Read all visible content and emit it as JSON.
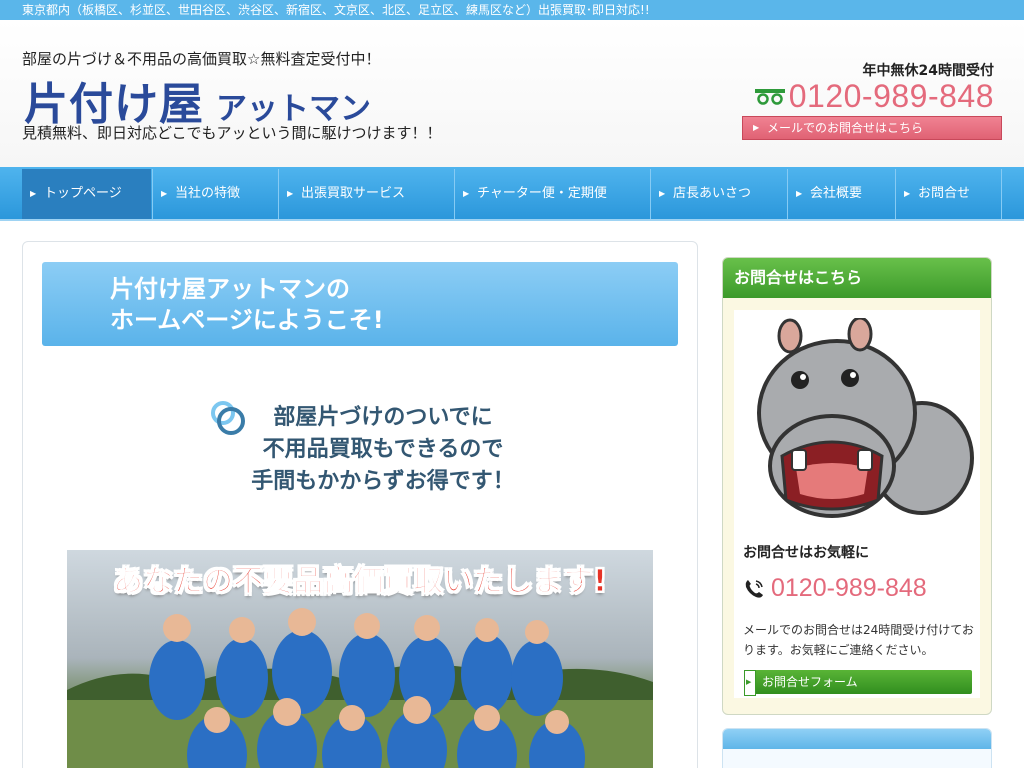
{
  "topbar": {
    "text": "東京都内（板橋区、杉並区、世田谷区、渋谷区、新宿区、文京区、北区、足立区、練馬区など）出張買取･即日対応!!"
  },
  "header": {
    "catch": "部屋の片づけ＆不用品の高価買取☆無料査定受付中！",
    "logo_main": "片付け屋",
    "logo_sub": "アットマン",
    "subtitle": "見積無料、即日対応どこでもアッという間に駆けつけます！！",
    "hours": "年中無休24時間受付",
    "phone": "0120-989-848",
    "mail_button": "メールでのお問合せはこちら"
  },
  "nav": {
    "items": [
      {
        "label": "トップページ"
      },
      {
        "label": "当社の特徴"
      },
      {
        "label": "出張買取サービス"
      },
      {
        "label": "チャーター便・定期便"
      },
      {
        "label": "店長あいさつ"
      },
      {
        "label": "会社概要"
      },
      {
        "label": "お問合せ"
      }
    ]
  },
  "main": {
    "welcome_line1": "片付け屋アットマンの",
    "welcome_line2": "ホームページにようこそ!",
    "lead_line1": "部屋片づけのついでに",
    "lead_line2": "不用品買取もできるので",
    "lead_line3": "手間もかからずお得です！",
    "photo_headline": "あなたの不要品高価買取いたします!"
  },
  "side": {
    "heading": "お問合せはこちら",
    "label": "お問合せはお気軽に",
    "phone": "0120-989-848",
    "text": "メールでのお問合せは24時間受け付けております。お気軽にご連絡ください。",
    "form_button": "お問合せフォーム"
  }
}
